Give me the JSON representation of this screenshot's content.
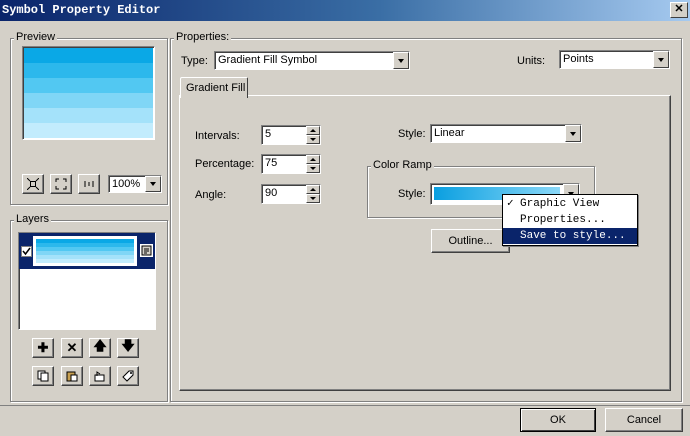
{
  "window": {
    "title": "Symbol Property Editor",
    "close_glyph": "✕"
  },
  "preview": {
    "label": "Preview",
    "zoom": "100%",
    "gradient_colors": [
      "#0aa8e6",
      "#2cb8ec",
      "#52c8f2",
      "#80d6f6",
      "#a4e2fa",
      "#c2ecfd"
    ]
  },
  "layers": {
    "label": "Layers"
  },
  "properties": {
    "label": "Properties:",
    "type_label": "Type:",
    "type_value": "Gradient Fill Symbol",
    "units_label": "Units:",
    "units_value": "Points",
    "tab_label": "Gradient Fill",
    "intervals_label": "Intervals:",
    "intervals_value": "5",
    "percentage_label": "Percentage:",
    "percentage_value": "75",
    "angle_label": "Angle:",
    "angle_value": "90",
    "style_label": "Style:",
    "style_value": "Linear",
    "color_ramp_label": "Color Ramp",
    "ramp_style_label": "Style:",
    "outline_label": "Outline...",
    "ramp_colors": [
      "#0a9fe0",
      "#8ad8f8"
    ]
  },
  "context_menu": {
    "items": [
      {
        "label": "Graphic View",
        "checked": true
      },
      {
        "label": "Properties...",
        "checked": false
      },
      {
        "label": "Save to style...",
        "checked": false
      }
    ]
  },
  "buttons": {
    "ok": "OK",
    "cancel": "Cancel"
  },
  "colors": {
    "highlight": "#0a246a",
    "face": "#d4d0c8"
  }
}
